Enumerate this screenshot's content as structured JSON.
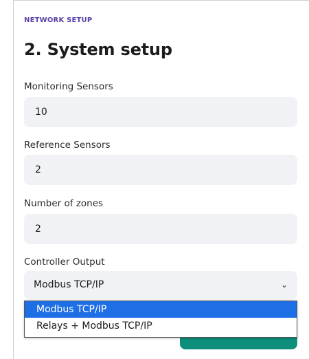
{
  "section": {
    "eyebrow": "NETWORK SETUP",
    "title": "2. System setup"
  },
  "fields": [
    {
      "label": "Monitoring Sensors",
      "value": "10"
    },
    {
      "label": "Reference Sensors",
      "value": "2"
    },
    {
      "label": "Number of zones",
      "value": "2"
    }
  ],
  "controller_output": {
    "label": "Controller Output",
    "selected": "Modbus TCP/IP",
    "options": [
      "Modbus TCP/IP",
      "Relays + Modbus TCP/IP"
    ],
    "highlighted_index": 0
  },
  "colors": {
    "accent": "#5b3fa8",
    "button": "#0e8f7c",
    "selection": "#1e6fe6"
  }
}
